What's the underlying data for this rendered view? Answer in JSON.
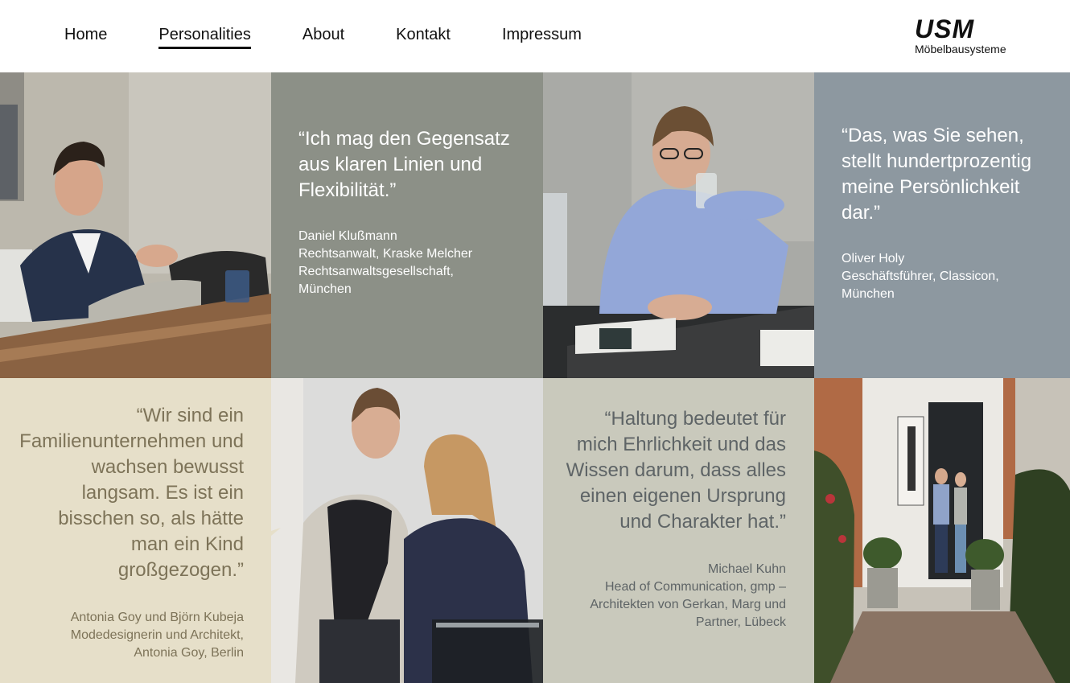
{
  "nav": {
    "items": [
      {
        "label": "Home",
        "active": false
      },
      {
        "label": "Personalities",
        "active": true
      },
      {
        "label": "About",
        "active": false
      },
      {
        "label": "Kontakt",
        "active": false
      },
      {
        "label": "Impressum",
        "active": false
      }
    ]
  },
  "logo": {
    "mark": "USM",
    "sub": "Möbelbausysteme"
  },
  "tiles": {
    "t2": {
      "quote": "“Ich mag den Gegensatz aus klaren Linien und Flexibilität.”",
      "author_name": "Daniel Klußmann",
      "author_role": "Rechtsanwalt, Kraske Melcher Rechtsanwaltsgesellschaft,",
      "author_city": "München",
      "bg": "#8c9087"
    },
    "t4": {
      "quote": "“Das, was Sie sehen, stellt hundertprozentig meine Persönlichkeit dar.”",
      "author_name": "Oliver Holy",
      "author_role": "Geschäftsführer, Classicon,",
      "author_city": "München",
      "bg": "#8d98a0"
    },
    "t5": {
      "quote": "“Wir sind ein Familienunternehmen und wachsen bewusst langsam. Es ist ein bisschen so, als hätte man ein Kind großgezogen.”",
      "author_name": "Antonia Goy und Björn Kubeja",
      "author_role": "Modedesignerin und Architekt,",
      "author_city": "Antonia Goy, Berlin",
      "bg": "#e6dfc9"
    },
    "t7": {
      "quote": "“Haltung bedeutet für mich Ehrlichkeit und das Wissen darum, dass alles einen eigenen Ursprung und Charakter hat.”",
      "author_name": "Michael Kuhn",
      "author_role": "Head of Communication, gmp –",
      "author_city": "Architekten von Gerkan, Marg und Partner, Lübeck",
      "bg": "#c9c9bc"
    }
  },
  "colors": {
    "quote_light": "#ffffff",
    "quote_beige": "#7d7358",
    "quote_gray": "#5e6466"
  }
}
